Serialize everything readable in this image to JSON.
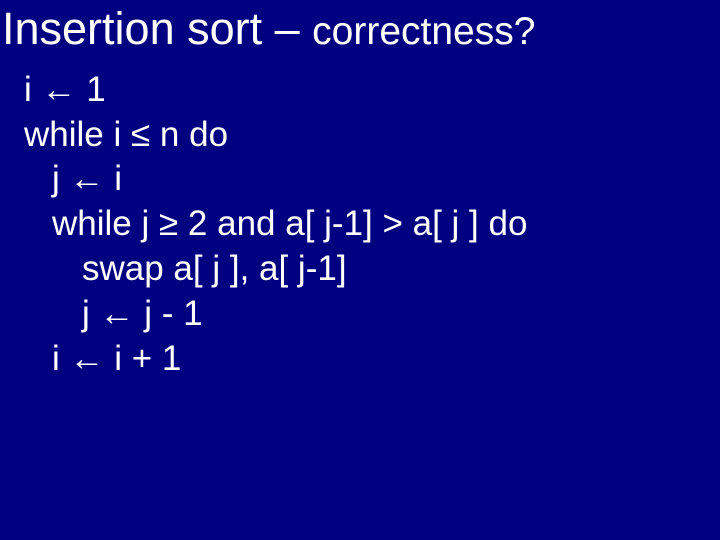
{
  "title": {
    "main": "Insertion sort – ",
    "sub": "correctness?"
  },
  "code": {
    "l1": "i ← 1",
    "l2": "while i ≤ n do",
    "l3": "j ← i",
    "l4": "while j ≥ 2 and a[ j-1] > a[ j ] do",
    "l5": "swap a[ j ], a[ j-1]",
    "l6": "j ← j - 1",
    "l7": "i ← i + 1"
  }
}
